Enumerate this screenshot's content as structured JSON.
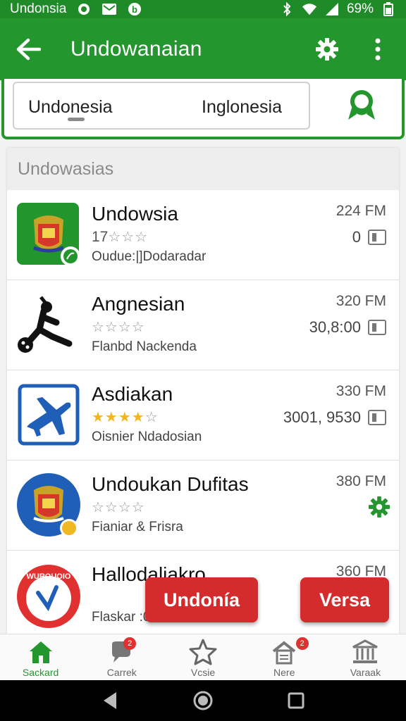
{
  "status_bar": {
    "carrier": "Undonsia",
    "battery": "69%",
    "icons": [
      "whatsapp-icon",
      "mail-icon",
      "b-app-icon",
      "bluetooth-icon",
      "wifi-icon",
      "signal-icon",
      "battery-icon"
    ]
  },
  "app_bar": {
    "title": "Undowanaian",
    "back_icon": "arrow-left-icon",
    "settings_icon": "gear-icon",
    "menu_icon": "more-vertical-icon"
  },
  "translator": {
    "source_lang": "Undonesia",
    "target_lang": "Inglonesia",
    "action_icon": "map-pin-icon"
  },
  "list": {
    "header": "Undowasias",
    "items": [
      {
        "name": "Undowsia",
        "rating_prefix": "17",
        "stars": "☆☆☆",
        "stars_filled": "",
        "subtitle": "Oudue:|]Dodaradar",
        "time": "224 FM",
        "count": "0",
        "icon": "coat-of-arms-icon"
      },
      {
        "name": "Angnesian",
        "rating_prefix": "",
        "stars": "☆☆☆☆",
        "stars_filled": "",
        "subtitle": "Flanbd Nackenda",
        "time": "320 FM",
        "count": "30,8:00",
        "icon": "athlete-icon"
      },
      {
        "name": "Asdiakan",
        "rating_prefix": "",
        "stars": "☆",
        "stars_filled": "★★★★",
        "subtitle": "Oisnier Ndadosian",
        "time": "330 FM",
        "count": "3001, 9530",
        "icon": "airplane-icon"
      },
      {
        "name": "Undoukan Dufitas",
        "rating_prefix": "",
        "stars": "☆☆☆☆",
        "stars_filled": "",
        "subtitle": "Fianiar & Frisra",
        "time": "380 FM",
        "count": "",
        "icon": "coat-of-arms-round-icon"
      },
      {
        "name": "Hallodaliakro",
        "rating_prefix": "",
        "stars": "",
        "stars_filled": "",
        "subtitle": "Flaskar :0",
        "time": "360 FM",
        "count": "",
        "icon": "check-badge-icon",
        "badge_text": "WUROUOIO"
      }
    ]
  },
  "floating_buttons": {
    "primary": "Undonía",
    "secondary": "Versa"
  },
  "bottom_nav": [
    {
      "label": "Sackard",
      "icon": "home-icon"
    },
    {
      "label": "Carrek",
      "icon": "chat-icon"
    },
    {
      "label": "Vcsie",
      "icon": "star-icon"
    },
    {
      "label": "Nere",
      "icon": "house-alert-icon"
    },
    {
      "label": "Varaak",
      "icon": "bank-icon"
    }
  ],
  "colors": {
    "brand_green": "#23962e",
    "accent_red": "#d42c2c",
    "star_gold": "#f2b51d"
  }
}
